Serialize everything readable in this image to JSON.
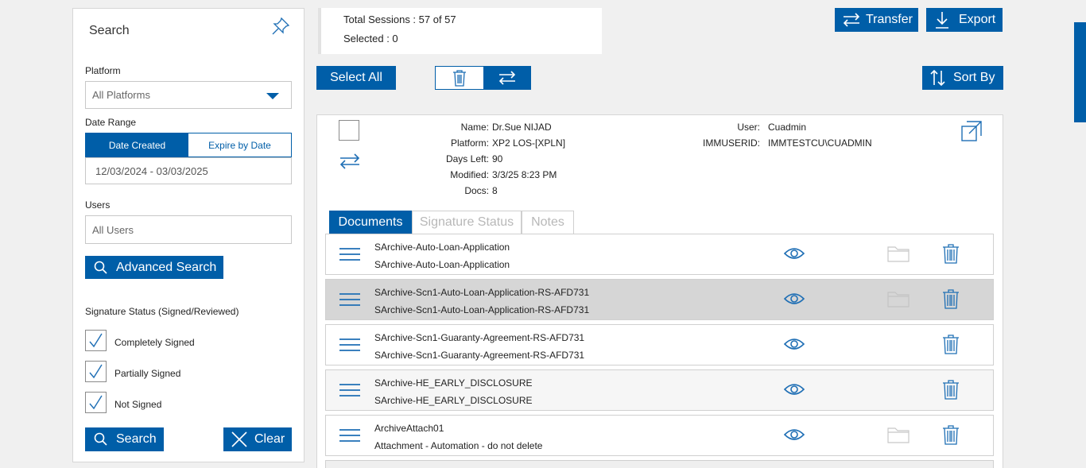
{
  "search_panel": {
    "title": "Search",
    "platform_label": "Platform",
    "platform_value": "All Platforms",
    "date_range_label": "Date Range",
    "date_tabs": [
      "Date Created",
      "Expire by Date"
    ],
    "date_value": "12/03/2024 - 03/03/2025",
    "users_label": "Users",
    "users_placeholder": "All Users",
    "advanced_search_label": "Advanced Search",
    "signature_status_label": "Signature Status (Signed/Reviewed)",
    "checkboxes": [
      {
        "label": "Completely Signed",
        "checked": true
      },
      {
        "label": "Partially Signed",
        "checked": true
      },
      {
        "label": "Not Signed",
        "checked": true
      }
    ],
    "search_label": "Search",
    "clear_label": "Clear"
  },
  "summary": {
    "total_sessions": "Total Sessions : 57 of 57",
    "selected": "Selected : 0"
  },
  "toolbar": {
    "select_all_label": "Select All",
    "transfer_label": "Transfer",
    "export_label": "Export",
    "sort_by_label": "Sort By"
  },
  "session": {
    "fields_left": [
      {
        "key": "Name:",
        "value": "Dr.Sue NIJAD"
      },
      {
        "key": "Platform:",
        "value": "XP2 LOS-[XPLN]"
      },
      {
        "key": "Days Left:",
        "value": "90"
      },
      {
        "key": "Modified:",
        "value": "3/3/25 8:23 PM"
      },
      {
        "key": "Docs:",
        "value": "8"
      }
    ],
    "fields_right": [
      {
        "key": "User:",
        "value": "Cuadmin"
      },
      {
        "key": "IMMUSERID:",
        "value": "IMMTESTCU\\CUADMIN"
      }
    ],
    "tabs": [
      "Documents",
      "Signature Status",
      "Notes"
    ],
    "active_tab": "Documents"
  },
  "documents": [
    {
      "title": "SArchive-Auto-Loan-Application",
      "subtitle": "SArchive-Auto-Loan-Application",
      "highlighted": false,
      "folder_faded": false
    },
    {
      "title": "SArchive-Scn1-Auto-Loan-Application-RS-AFD731",
      "subtitle": "SArchive-Scn1-Auto-Loan-Application-RS-AFD731",
      "highlighted": true,
      "folder_faded": true
    },
    {
      "title": "SArchive-Scn1-Guaranty-Agreement-RS-AFD731",
      "subtitle": "SArchive-Scn1-Guaranty-Agreement-RS-AFD731",
      "highlighted": false,
      "folder_faded": null
    },
    {
      "title": "SArchive-HE_EARLY_DISCLOSURE",
      "subtitle": "SArchive-HE_EARLY_DISCLOSURE",
      "highlighted": false,
      "folder_faded": null
    },
    {
      "title": "ArchiveAttach01",
      "subtitle": "Attachment - Automation - do not delete",
      "highlighted": false,
      "folder_faded": false
    }
  ],
  "colors": {
    "accent": "#005ea8",
    "icon": "#1f6fb5",
    "page_bg": "#f0f0f0"
  }
}
